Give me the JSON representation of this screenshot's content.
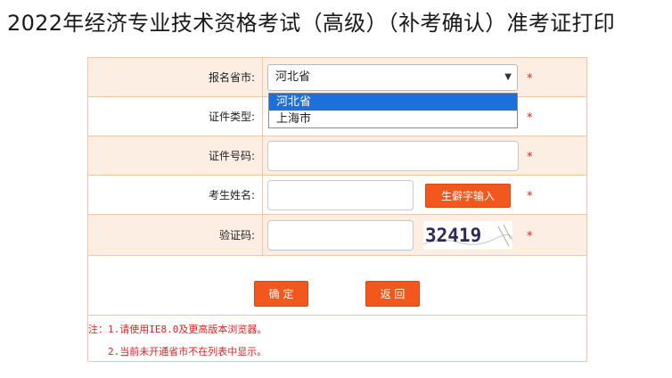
{
  "page": {
    "title": "2022年经济专业技术资格考试（高级）（补考确认）准考证打印"
  },
  "form": {
    "province_label": "报名省市:",
    "province_value": "河北省",
    "province_options": [
      "河北省",
      "上海市"
    ],
    "id_type_label": "证件类型:",
    "id_number_label": "证件号码:",
    "name_label": "考生姓名:",
    "rare_char_button": "生僻字输入",
    "captcha_label": "验证码:",
    "captcha_text": "32419",
    "required_mark": "*"
  },
  "actions": {
    "confirm_label": "确 定",
    "back_label": "返 回"
  },
  "notes": {
    "note1": "注：1.请使用IE8.0及更高版本浏览器。",
    "note2": "2.当前未开通省市不在列表中显示。"
  },
  "colors": {
    "accent": "#f2571d",
    "row_shade": "#fdeee3",
    "border": "#f0c7a6",
    "required": "#e02020",
    "dropdown_highlight": "#1e6fd9"
  }
}
